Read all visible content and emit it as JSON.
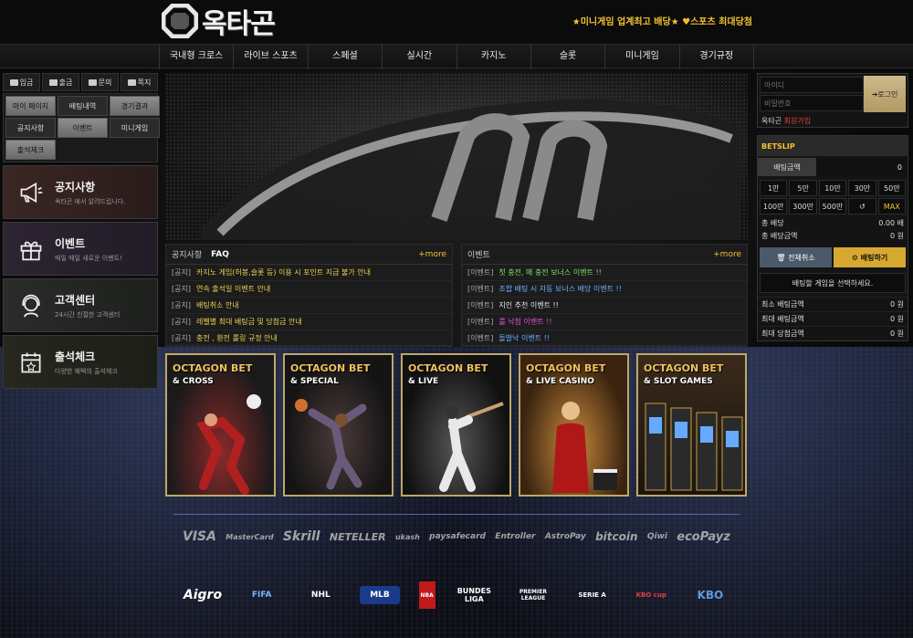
{
  "header": {
    "logo_text": "옥타곤",
    "tagline": "★미니게임 업계최고 배당★ ♥스포츠 최대당첨"
  },
  "nav": [
    "국내형 크로스",
    "라이브 스포츠",
    "스페셜",
    "실시간",
    "카지노",
    "슬롯",
    "미니게임",
    "경기규정"
  ],
  "quick": [
    {
      "icon": "deposit-icon",
      "label": "입금"
    },
    {
      "icon": "withdraw-icon",
      "label": "출금"
    },
    {
      "icon": "chat-icon",
      "label": "문의"
    },
    {
      "icon": "mail-icon",
      "label": "쪽지"
    }
  ],
  "menu": [
    "마이 페이지",
    "배팅내역",
    "경기결과",
    "공지사항",
    "이벤트",
    "미니게임",
    "출석체크"
  ],
  "panels": [
    {
      "title": "공지사항",
      "sub": "옥타곤 에서 알려드립니다.",
      "icon": "megaphone-icon"
    },
    {
      "title": "이벤트",
      "sub": "매일 매일 새로운 이벤트!",
      "icon": "gift-icon"
    },
    {
      "title": "고객센터",
      "sub": "24시간 친절한 고객센터",
      "icon": "headset-icon"
    },
    {
      "title": "출석체크",
      "sub": "다양한 혜택의 출석체크",
      "icon": "calendar-icon"
    }
  ],
  "notice_board": {
    "tabs": [
      "공지사항",
      "FAQ"
    ],
    "more": "+more",
    "rows": [
      {
        "tag": "[공지]",
        "text": "카지노 게임(허봉,슬롯 등) 이용 시 포인트 지급 불가 안내"
      },
      {
        "tag": "[공지]",
        "text": "연속 출석일 이벤트 안내"
      },
      {
        "tag": "[공지]",
        "text": "배팅취소 안내"
      },
      {
        "tag": "[공지]",
        "text": "레벨별 최대 배팅금 및 당첨금 안내"
      },
      {
        "tag": "[공지]",
        "text": "충전 , 환전 롤링 규정 안내"
      }
    ]
  },
  "event_board": {
    "title": "이벤트",
    "more": "+more",
    "rows": [
      {
        "tag": "[이벤트]",
        "text": "첫 충전, 매 충전 보너스 이벤트 !!",
        "color": "#7ee06a"
      },
      {
        "tag": "[이벤트]",
        "text": "조합 배팅 시 자동 보너스 배당 이벤트 !!",
        "color": "#6ab0ff"
      },
      {
        "tag": "[이벤트]",
        "text": "지인 추천 이벤트 !!",
        "color": "#e8e8e8"
      },
      {
        "tag": "[이벤트]",
        "text": "룰 낙첨 이벤트 !!",
        "color": "#e050e0"
      },
      {
        "tag": "[이벤트]",
        "text": "돌발낙 이벤트 !!",
        "color": "#6ab0ff"
      }
    ]
  },
  "game_cards": [
    {
      "brand": "OCTAGON BET",
      "sub": "& CROSS"
    },
    {
      "brand": "OCTAGON BET",
      "sub": "& SPECIAL"
    },
    {
      "brand": "OCTAGON BET",
      "sub": "& LIVE"
    },
    {
      "brand": "OCTAGON BET",
      "sub": "& LIVE CASINO"
    },
    {
      "brand": "OCTAGON BET",
      "sub": "& SLOT GAMES"
    }
  ],
  "payments": [
    "VISA",
    "MasterCard",
    "Skrill",
    "NETELLER",
    "ukash",
    "paysafecard",
    "Entroller",
    "AstroPay",
    "bitcoin",
    "Qiwi",
    "ecoPayz"
  ],
  "leagues": [
    "Aigro",
    "FIFA",
    "NHL",
    "MLB",
    "NBA",
    "BUNDES LIGA",
    "PREMIER LEAGUE",
    "SERIE A",
    "KBO cup",
    "KBO"
  ],
  "login": {
    "id_placeholder": "아이디",
    "pw_placeholder": "비밀번호",
    "button": "로그인",
    "link_label": "옥타곤",
    "register": "회원가입"
  },
  "betslip": {
    "title": "BETSLIP",
    "amount_label": "배팅금액",
    "amount_value": "0",
    "chips": [
      "1만",
      "5만",
      "10만",
      "30만",
      "50만",
      "100만",
      "300만",
      "500만",
      "↺",
      "MAX"
    ],
    "total_odds_label": "총 배당",
    "total_odds_value": "0.00 배",
    "total_win_label": "총 배당금액",
    "total_win_value": "0 원",
    "cancel_all": "전체취소",
    "place_bet": "배팅하기",
    "notice": "배팅할 게임을 선택하세요.",
    "min_bet_label": "최소 배팅금액",
    "min_bet_value": "0 원",
    "max_bet_label": "최대 배팅금액",
    "max_bet_value": "0 원",
    "max_win_label": "최대 당첨금액",
    "max_win_value": "0 원"
  },
  "colors": {
    "accent": "#f2c230",
    "gold_button": "#d8a930",
    "register": "#e04040"
  }
}
